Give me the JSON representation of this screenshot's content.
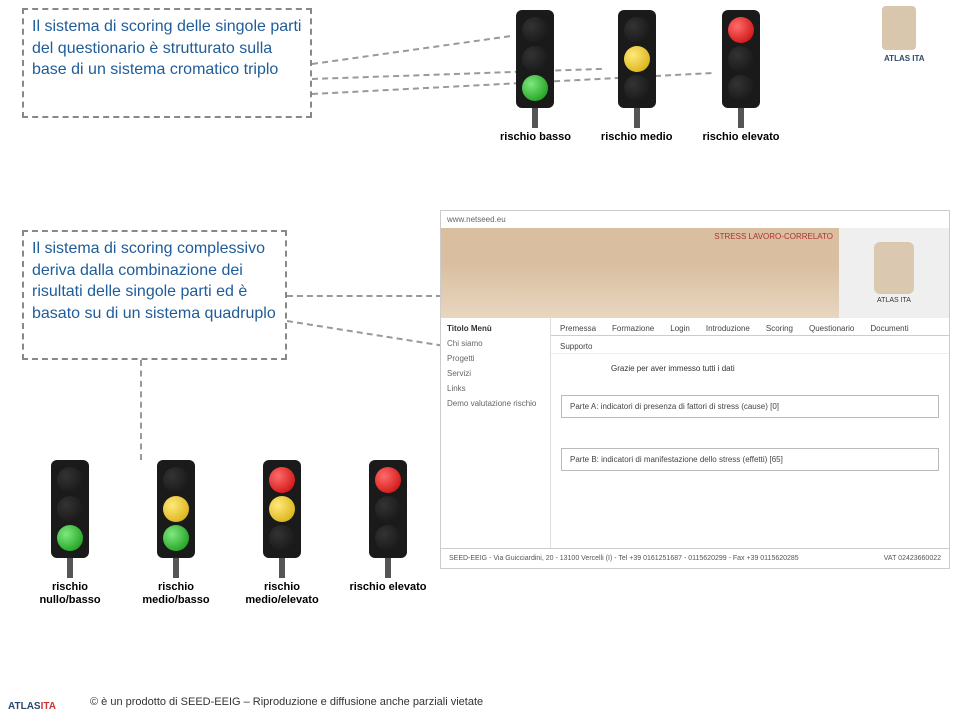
{
  "box1": {
    "text": "Il sistema di scoring delle singole parti del questionario è strutturato sulla base di un sistema cromatico triplo"
  },
  "box2": {
    "text": "Il sistema di scoring complessivo deriva dalla combinazione dei risultati delle singole parti ed è basato su di un sistema quadruplo"
  },
  "triplo": {
    "labels": [
      "rischio basso",
      "rischio medio",
      "rischio elevato"
    ]
  },
  "quadruplo": {
    "labels": [
      "rischio nullo/basso",
      "rischio medio/basso",
      "rischio medio/elevato",
      "rischio elevato"
    ]
  },
  "site": {
    "url": "www.netseed.eu",
    "stress_label": "STRESS LAVORO-CORRELATO",
    "logo_brand": "ATLAS ITA",
    "menu_title": "Titolo Menù",
    "menu_items": [
      "Chi siamo",
      "Progetti",
      "Servizi",
      "Links",
      "Demo valutazione rischio"
    ],
    "tabs": [
      "Premessa",
      "Formazione",
      "Login",
      "Introduzione",
      "Scoring",
      "Questionario",
      "Documenti"
    ],
    "support": "Supporto",
    "thanks": "Grazie per aver immesso tutti i dati",
    "part_a": "Parte A: indicatori di presenza di fattori di stress (cause) [0]",
    "part_b": "Parte B: indicatori di manifestazione dello stress (effetti) [65]",
    "footer_left": "SEED-EEIG - Via Guicciardini, 20 - 13100 Vercelli (I) - Tel +39 0161251687 - 0115620299 - Fax +39 0115620285",
    "footer_right": "VAT 02423660022"
  },
  "copyright": "© è un prodotto di SEED-EEIG – Riproduzione e diffusione anche parziali vietate",
  "logo_upper": "ATLAS ITA"
}
